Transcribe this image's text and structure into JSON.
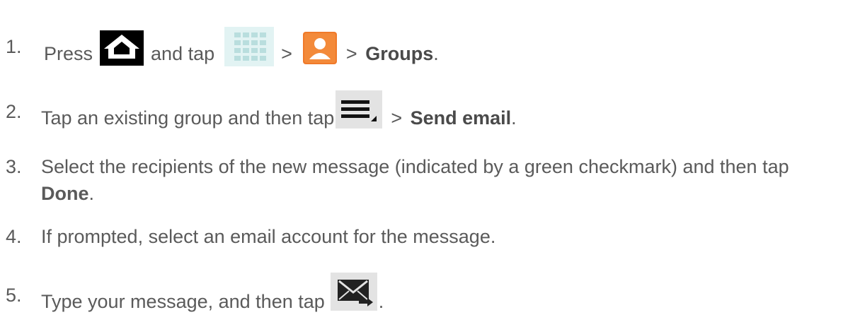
{
  "steps": [
    {
      "num": "1.",
      "press": "Press",
      "and_tap": "and tap",
      "sep1": ">",
      "sep2": ">",
      "groups": "Groups",
      "end": "."
    },
    {
      "num": "2.",
      "text": "Tap an existing group and then tap",
      "sep": ">",
      "send_email": "Send email",
      "end": "."
    },
    {
      "num": "3.",
      "text": "Select the recipients of the new message (indicated by a green checkmark) and then tap",
      "done": "Done",
      "end": "."
    },
    {
      "num": "4.",
      "text": "If prompted, select an email account for the message."
    },
    {
      "num": "5.",
      "text": "Type your message, and then tap",
      "end": "."
    }
  ],
  "icons": {
    "home": "home-icon",
    "apps": "apps-grid-icon",
    "contacts": "contacts-icon",
    "menu": "menu-icon",
    "send": "send-message-icon"
  },
  "colors": {
    "text": "#5a5a5a",
    "contacts_orange": "#f07a2a",
    "apps_bg": "#e2f3f3"
  }
}
